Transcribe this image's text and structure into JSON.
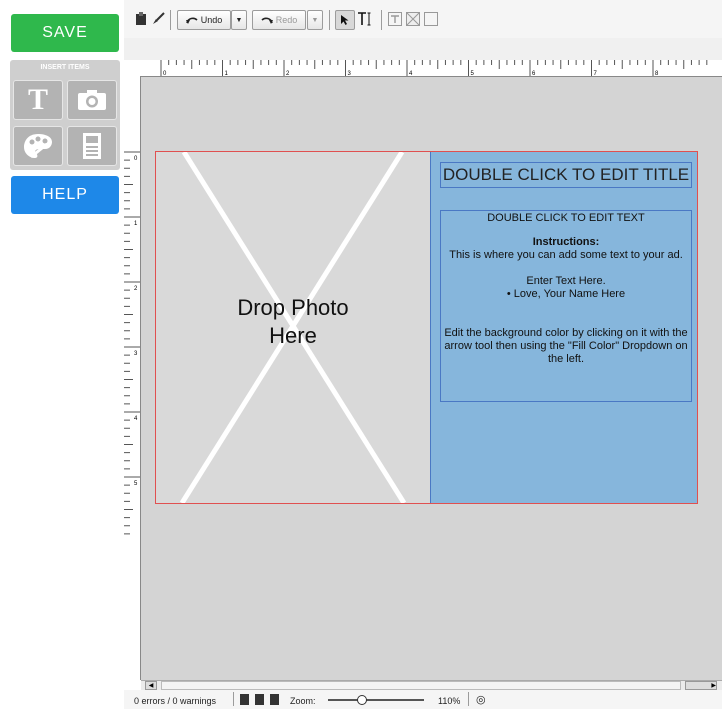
{
  "sidebar": {
    "save_label": "SAVE",
    "insert_title": "INSERT ITEMS",
    "insert_items": [
      {
        "icon": "text-icon",
        "glyph": "T"
      },
      {
        "icon": "camera-icon"
      },
      {
        "icon": "palette-icon"
      },
      {
        "icon": "page-layout-icon"
      }
    ],
    "help_label": "HELP"
  },
  "toolbar": {
    "undo_label": "Undo",
    "redo_label": "Redo"
  },
  "rulers": {
    "h_ticks": [
      "0",
      "1",
      "2",
      "3",
      "4",
      "5",
      "6",
      "7",
      "8"
    ],
    "v_ticks": [
      "0",
      "1",
      "2",
      "3",
      "4",
      "5"
    ]
  },
  "canvas": {
    "photo_text_line1": "Drop Photo",
    "photo_text_line2": "Here",
    "title_text": "DOUBLE CLICK TO EDIT TITLE",
    "body_heading": "DOUBLE CLICK TO EDIT TEXT",
    "instructions_label": "Instructions:",
    "instructions_text": "This is where you can add some text to your ad.",
    "enter_text": "Enter Text Here.",
    "love_text": "• Love, Your Name Here",
    "edit_bg_text": "Edit the background color by clicking on it with the arrow tool then using the \"Fill Color\" Dropdown on the left.",
    "background_color": "#86b6dc"
  },
  "status": {
    "errors_text": "0 errors / 0 warnings",
    "zoom_label": "Zoom:",
    "zoom_value": "110%",
    "zoom_fraction": 0.35
  },
  "colors": {
    "save": "#2fb84c",
    "help": "#1e88e8"
  }
}
